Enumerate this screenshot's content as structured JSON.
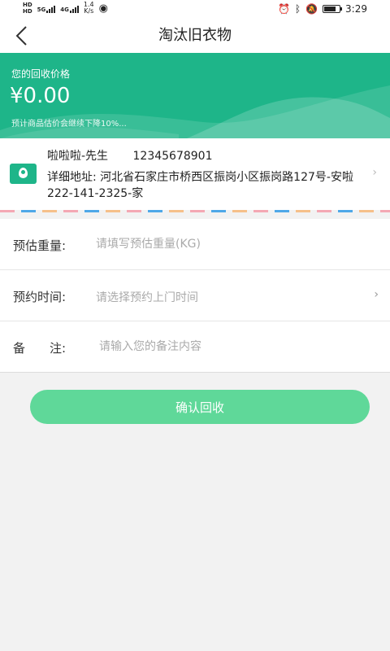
{
  "status_bar": {
    "network_type": "HD",
    "signal_1_label": "5G",
    "signal_2_label": "4G",
    "speed_value": "1.4",
    "speed_unit": "K/s",
    "time": "3:29",
    "battery_level": 0.8
  },
  "nav": {
    "title": "淘汰旧衣物"
  },
  "price": {
    "label": "您的回收价格",
    "value": "¥0.00",
    "note": "预计商品估价会继续下降10%..."
  },
  "address": {
    "name": "啦啦啦-先生",
    "phone": "12345678901",
    "detail": "详细地址: 河北省石家庄市桥西区振岗小区振岗路127号-安啦222-141-2325-家"
  },
  "form": {
    "weight_label": "预估重量:",
    "weight_placeholder": "请填写预估重量(KG)",
    "time_label": "预约时间:",
    "time_placeholder": "请选择预约上门时间",
    "note_label": "备　　注:",
    "note_placeholder": "请输入您的备注内容"
  },
  "confirm_label": "确认回收",
  "colors": {
    "accent": "#1eb589",
    "button": "#5fd899",
    "background": "#f2f2f2"
  }
}
